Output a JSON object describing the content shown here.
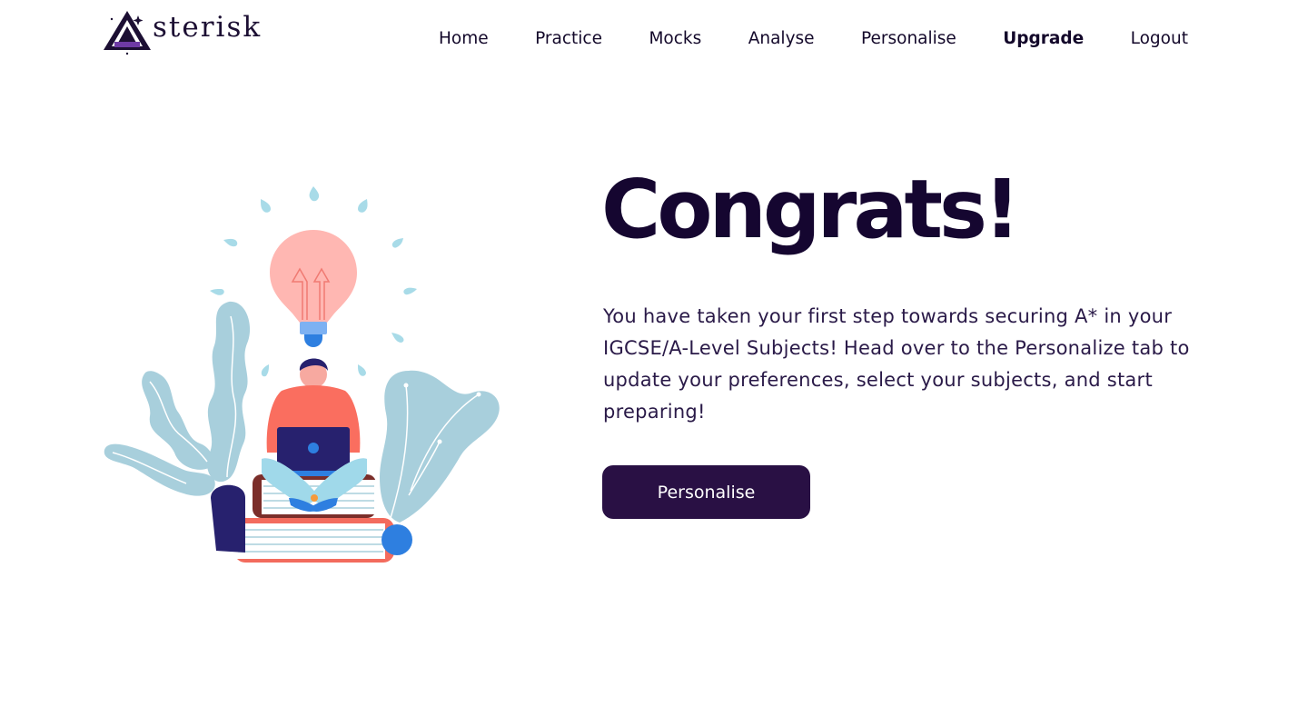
{
  "header": {
    "logo": {
      "text": "sterisk",
      "icon": "asterisk-a-logo-icon"
    },
    "nav": [
      {
        "label": "Home"
      },
      {
        "label": "Practice"
      },
      {
        "label": "Mocks"
      },
      {
        "label": "Analyse"
      },
      {
        "label": "Personalise"
      },
      {
        "label": "Upgrade",
        "emphasis": "bold"
      },
      {
        "label": "Logout"
      }
    ]
  },
  "main": {
    "illustration_icon": "student-with-laptop-lightbulb-illustration",
    "headline": "Congrats!",
    "message": "You have taken your first step towards securing A* in your IGCSE/A-Level Subjects! Head over to the Personalize tab to update your preferences, select your subjects, and start preparing!",
    "cta_label": "Personalise"
  },
  "colors": {
    "brand_dark": "#291044",
    "text_dark": "#150630",
    "leaf_blue": "#a8cfdc",
    "bulb_pink": "#ffb7b2",
    "shirt_coral": "#fa6e5f",
    "laptop_navy": "#27216e",
    "accent_blue": "#2e7fe0"
  }
}
